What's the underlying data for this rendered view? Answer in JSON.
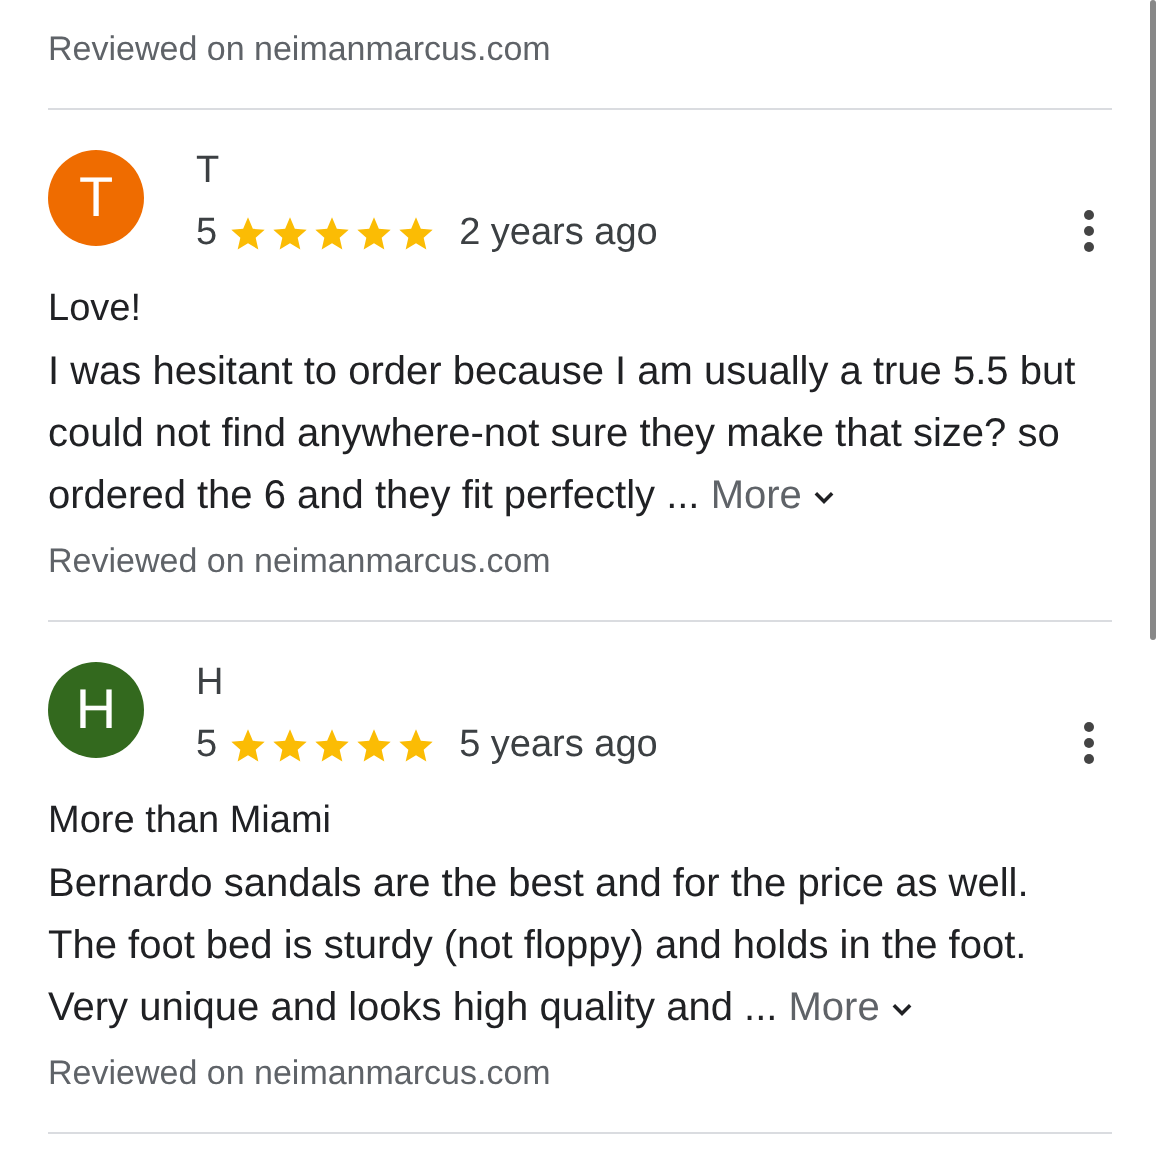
{
  "previous_review": {
    "source": "Reviewed on neimanmarcus.com"
  },
  "reviews": [
    {
      "initial": "T",
      "color": "#ef6c00",
      "name": "T",
      "rating": "5",
      "stars": 5,
      "time": "2 years ago",
      "title": "Love!",
      "body": "I was hesitant to order because I am usually a true 5.5 but could not find anywhere-not sure they make that size? so ordered the 6 and they fit perfectly ...",
      "more": "More",
      "source": "Reviewed on neimanmarcus.com"
    },
    {
      "initial": "H",
      "color": "#33691e",
      "name": "H",
      "rating": "5",
      "stars": 5,
      "time": "5 years ago",
      "title": "More than Miami",
      "body": "Bernardo sandals are the best and for the price as well. The foot bed is sturdy (not floppy) and holds in the foot. Very unique and looks high quality and ...",
      "more": "More",
      "source": "Reviewed on neimanmarcus.com"
    }
  ]
}
